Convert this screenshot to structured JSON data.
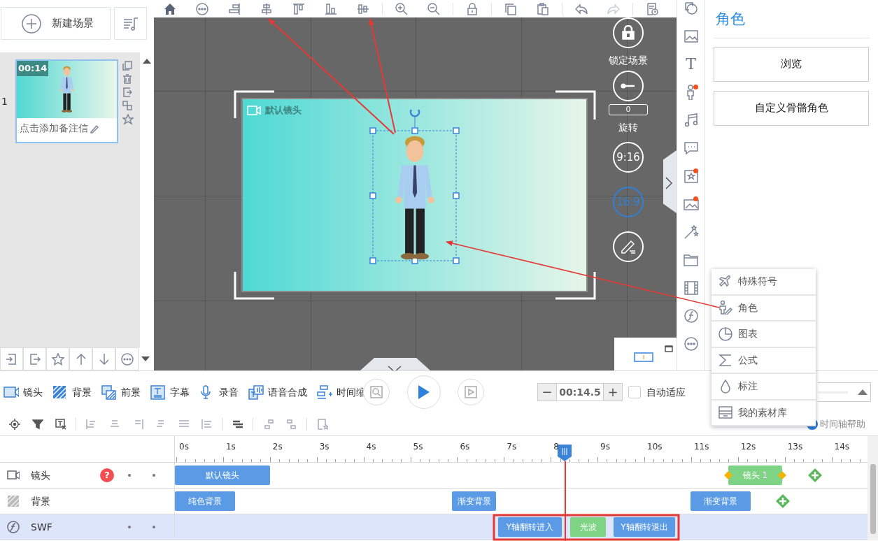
{
  "left_panel": {
    "new_scene_button": "新建场景",
    "scenes": [
      {
        "number": "1",
        "duration": "00:14",
        "note": "点击添加备注信",
        "selected": true
      }
    ]
  },
  "canvas": {
    "camera_label": "默认镜头",
    "lock_label": "锁定场景",
    "rotation_value": "0",
    "rotation_label": "旋转",
    "ratios": [
      {
        "label": "9:16",
        "selected": false
      },
      {
        "label": "16:9",
        "selected": true
      }
    ]
  },
  "tool_strip": [
    {
      "dot": false
    },
    {
      "dot": false
    },
    {
      "label": "T",
      "dot": false
    },
    {
      "dot": true
    },
    {
      "dot": false
    },
    {
      "dot": false
    },
    {
      "dot": true
    },
    {
      "dot": true
    },
    {
      "dot": false
    },
    {
      "dot": false
    },
    {
      "dot": false
    },
    {
      "dot": false
    },
    {
      "dot": false
    }
  ],
  "right_panel": {
    "title": "角色",
    "buttons": [
      "浏览",
      "自定义骨骼角色"
    ]
  },
  "popup_menu": [
    "特殊符号",
    "角色",
    "图表",
    "公式",
    "标注",
    "我的素材库"
  ],
  "track_tabs": [
    "镜头",
    "背景",
    "前景",
    "字幕",
    "录音",
    "语音合成",
    "时间缩"
  ],
  "duration": {
    "decrement": "−",
    "value": "00:14.5",
    "increment": "+"
  },
  "auto_fit": {
    "label": "自动适应",
    "checked": false
  },
  "help_link": "时间轴帮助",
  "timeline": {
    "ticks": [
      "0s",
      "1s",
      "2s",
      "3s",
      "4s",
      "5s",
      "6s",
      "7s",
      "8",
      "9s",
      "10s",
      "11s",
      "12s",
      "13s",
      "14s"
    ],
    "tracks": [
      {
        "name": "镜头",
        "selected": false,
        "help": "?",
        "keyframe_dots": true,
        "add_button": true,
        "clips": [
          {
            "label": "默认镜头",
            "color": "#5b9be6",
            "diamonds": false
          },
          {
            "label": "镜头 1",
            "color": "#7fd384",
            "diamonds": true
          }
        ]
      },
      {
        "name": "背景",
        "selected": false,
        "keyframe_dots": false,
        "add_button": true,
        "clips": [
          {
            "label": "纯色背景",
            "color": "#5b9be6",
            "diamonds": false
          },
          {
            "label": "渐变背景",
            "color": "#5b9be6",
            "diamonds": false
          },
          {
            "label": "渐变背景",
            "color": "#5b9be6",
            "diamonds": false
          }
        ]
      },
      {
        "name": "SWF",
        "selected": true,
        "keyframe_dots": true,
        "add_button": false,
        "clips": [
          {
            "label": "Y轴翻转进入",
            "color": "#5b9be6",
            "diamonds": false
          },
          {
            "label": "光波",
            "color": "#7fd384",
            "diamonds": false
          },
          {
            "label": "Y轴翻转退出",
            "color": "#5b9be6",
            "diamonds": false
          }
        ]
      }
    ]
  }
}
